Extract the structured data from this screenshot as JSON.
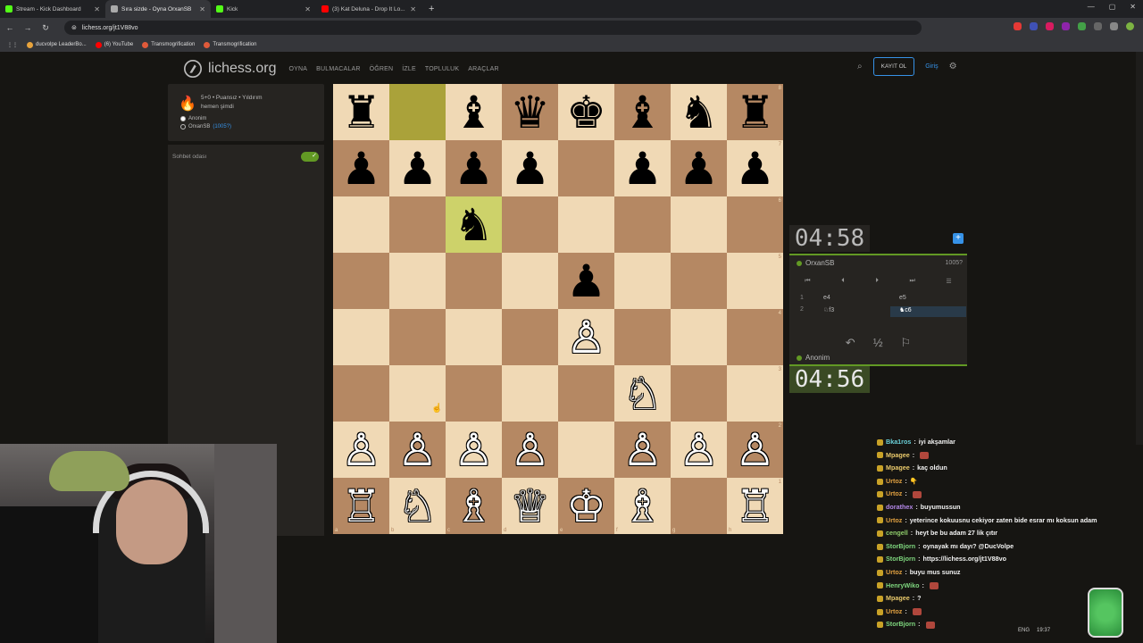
{
  "browser": {
    "tabs": [
      {
        "label": "Stream - Kick Dashboard",
        "color": "#53fc18",
        "active": false
      },
      {
        "label": "Sıra sizde - Oyna OrxanSB",
        "color": "#aaaaaa",
        "active": true
      },
      {
        "label": "Kick",
        "color": "#53fc18",
        "active": false
      },
      {
        "label": "(3) Kat Deluna - Drop It Lo...",
        "color": "#ff0000",
        "active": false
      }
    ],
    "url": "lichess.org/jt1V88vo",
    "bookmarks": [
      "ducvolpe LeaderBo...",
      "(6) YouTube",
      "Transmogrification",
      "Transmogrification"
    ]
  },
  "site": {
    "logo_text": "lichess.org",
    "nav": [
      "OYNA",
      "BULMACALAR",
      "ÖĞREN",
      "İZLE",
      "TOPLULUK",
      "ARAÇLAR"
    ],
    "register_label": "KAYIT OL",
    "login_label": "Giriş"
  },
  "game_info": {
    "line1": "5+0 • Puansız • Yıldırım",
    "line2": "hemen şimdi",
    "player1": "Anonim",
    "player2": "OrxanSB",
    "player2_rating": "(1005?)"
  },
  "chat_panel": {
    "label": "Sohbet odası",
    "enabled": true
  },
  "board": {
    "rows": [
      [
        "♜",
        "",
        "♝",
        "♛",
        "♚",
        "♝",
        "♞",
        "♜"
      ],
      [
        "♟",
        "♟",
        "♟",
        "♟",
        "",
        "♟",
        "♟",
        "♟"
      ],
      [
        "",
        "",
        "♞",
        "",
        "",
        "",
        "",
        ""
      ],
      [
        "",
        "",
        "",
        "",
        "♟",
        "",
        "",
        ""
      ],
      [
        "",
        "",
        "",
        "",
        "♙",
        "",
        "",
        ""
      ],
      [
        "",
        "",
        "",
        "",
        "",
        "♘",
        "",
        ""
      ],
      [
        "♙",
        "♙",
        "♙",
        "♙",
        "",
        "♙",
        "♙",
        "♙"
      ],
      [
        "♖",
        "♘",
        "♗",
        "♕",
        "♔",
        "♗",
        "",
        "♖"
      ]
    ],
    "ranks": [
      "8",
      "7",
      "6",
      "5",
      "4",
      "3",
      "2",
      "1"
    ],
    "files": [
      "a",
      "b",
      "c",
      "d",
      "e",
      "f",
      "g",
      "h"
    ],
    "highlight": [
      [
        0,
        1
      ],
      [
        2,
        2
      ]
    ]
  },
  "clocks": {
    "top": {
      "min": "04",
      "sec": "58"
    },
    "bottom": {
      "min": "04",
      "sec": "56"
    }
  },
  "players": {
    "top": {
      "name": "OrxanSB",
      "rating": "1005?"
    },
    "bottom": {
      "name": "Anonim"
    }
  },
  "moves": [
    {
      "num": "1",
      "white": "e4",
      "black": "e5"
    },
    {
      "num": "2",
      "white": "♘f3",
      "black": "♞c6"
    }
  ],
  "chat": [
    {
      "user": "Bka1ros",
      "text": "iyi akşamlar",
      "color": "#6ad0d8"
    },
    {
      "user": "Mpagee",
      "text": "",
      "color": "#e8c86a",
      "emote": true
    },
    {
      "user": "Mpagee",
      "text": "kaç oldun",
      "color": "#e8c86a"
    },
    {
      "user": "Urtoz",
      "text": "👇",
      "color": "#e0a040"
    },
    {
      "user": "Urtoz",
      "text": "",
      "color": "#e0a040",
      "emote": true
    },
    {
      "user": "dorathex",
      "text": "buyumussun",
      "color": "#b488e8"
    },
    {
      "user": "Urtoz",
      "text": "yeterince kokuusnu cekiyor zaten bide esrar mı koksun adam",
      "color": "#e0a040"
    },
    {
      "user": "cengell",
      "text": "heyt be bu adam 27 lik çıtır",
      "color": "#8ecb6a"
    },
    {
      "user": "StorBjorn",
      "text": "oynayak mı dayı? @DucVolpe",
      "color": "#7ed67e"
    },
    {
      "user": "StorBjorn",
      "text": "https://lichess.org/jt1V88vo",
      "color": "#7ed67e"
    },
    {
      "user": "Urtoz",
      "text": "buyu mus sunuz",
      "color": "#e0a040"
    },
    {
      "user": "HenryWiko",
      "text": "",
      "color": "#7ed67e",
      "emote": true
    },
    {
      "user": "Mpagee",
      "text": "?",
      "color": "#e8c86a"
    },
    {
      "user": "Urtoz",
      "text": "",
      "color": "#e0a040",
      "emote": true
    },
    {
      "user": "StorBjorn",
      "text": "",
      "color": "#7ed67e",
      "emote": true
    }
  ],
  "tray": {
    "lang": "ENG",
    "time": "19:37"
  }
}
